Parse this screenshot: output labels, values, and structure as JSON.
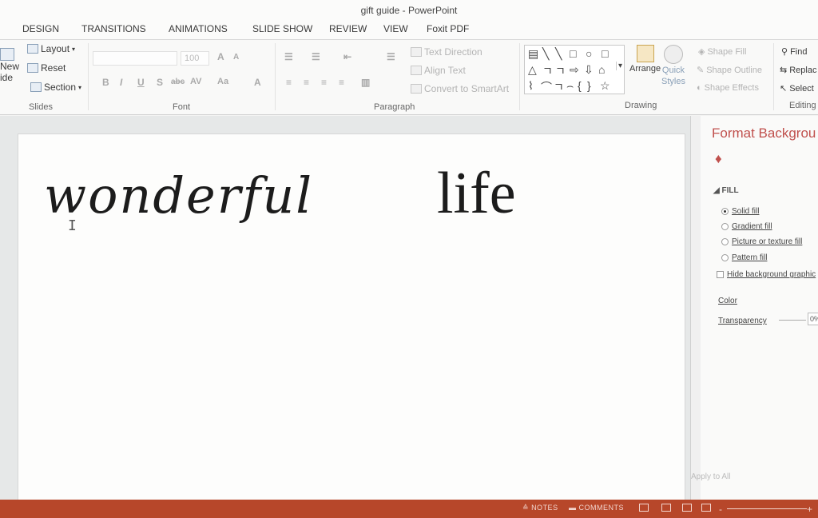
{
  "window": {
    "title": "gift guide - PowerPoint"
  },
  "tabs": [
    "DESIGN",
    "TRANSITIONS",
    "ANIMATIONS",
    "SLIDE SHOW",
    "REVIEW",
    "VIEW",
    "Foxit PDF"
  ],
  "ribbon": {
    "slides": {
      "new_line1": "New",
      "new_line2": "ide",
      "layout": "Layout",
      "reset": "Reset",
      "section": "Section",
      "label": "Slides"
    },
    "font": {
      "size": "100",
      "label": "Font",
      "bold": "B",
      "italic": "I",
      "underline": "U",
      "shadow": "S",
      "strike": "abc",
      "spacing": "AV",
      "case": "Aa",
      "grow": "A",
      "shrink": "A",
      "color": "A"
    },
    "paragraph": {
      "text_direction": "Text Direction",
      "align_text": "Align Text",
      "convert_smartart": "Convert to SmartArt",
      "label": "Paragraph"
    },
    "drawing": {
      "arrange": "Arrange",
      "quick_styles_line1": "Quick",
      "quick_styles_line2": "Styles",
      "shape_fill": "Shape Fill",
      "shape_outline": "Shape Outline",
      "shape_effects": "Shape Effects",
      "label": "Drawing",
      "shapes": [
        "▤",
        "╲",
        "╲",
        "□",
        "○",
        "□",
        "△",
        "ㄱ",
        "ㄱ",
        "⇨",
        "⇩",
        "⌂",
        "⌇",
        "⌒",
        "ㄱ",
        "⌢",
        "{",
        "}",
        "☆"
      ]
    },
    "editing": {
      "find": "Find",
      "replace": "Replac",
      "select": "Select",
      "label": "Editing"
    }
  },
  "slide": {
    "title_script": "wonderful",
    "title_serif": "life"
  },
  "pane": {
    "title": "Format Backgrou",
    "section": "FILL",
    "options": [
      {
        "label": "Solid fill",
        "selected": true
      },
      {
        "label": "Gradient fill",
        "selected": false
      },
      {
        "label": "Picture or texture fill",
        "selected": false
      },
      {
        "label": "Pattern fill",
        "selected": false
      }
    ],
    "hide_graphics": "Hide background graphic",
    "color_label": "Color",
    "transparency_label": "Transparency",
    "transparency_value": "0%",
    "apply_all": "Apply to All"
  },
  "statusbar": {
    "notes": "NOTES",
    "comments": "COMMENTS",
    "zoom_minus": "-",
    "zoom_plus": "+"
  },
  "colors": {
    "accent": "#c0504d",
    "statusbar": "#b7472a"
  }
}
